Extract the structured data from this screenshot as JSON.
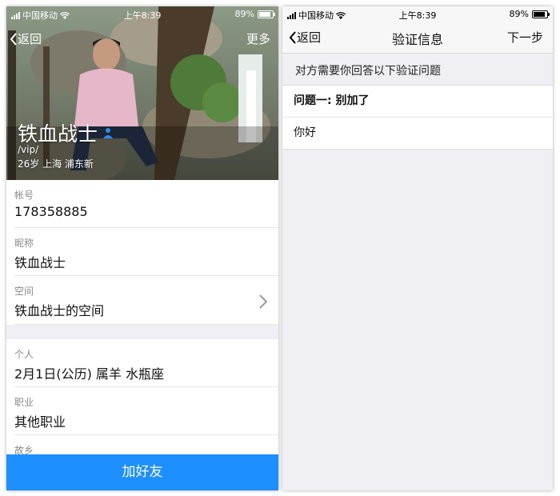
{
  "status_left": {
    "carrier": "中国移动",
    "time": "上午8:39",
    "battery": "89%"
  },
  "status_right": {
    "carrier": "中国移动",
    "time": "上午8:39",
    "battery": "89%"
  },
  "profile": {
    "back_label": "返回",
    "more_label": "更多",
    "name": "铁血战士",
    "vip": "/vip/",
    "info": "26岁 上海 浦东新",
    "rows": [
      {
        "label": "帐号",
        "value": "178358885"
      },
      {
        "label": "昵称",
        "value": "铁血战士"
      },
      {
        "label": "空间",
        "value": "铁血战士的空间"
      },
      {
        "label": "个人",
        "value": "2月1日(公历) 属羊 水瓶座"
      },
      {
        "label": "职业",
        "value": "其他职业"
      },
      {
        "label": "故乡",
        "value": ""
      }
    ],
    "add_friend_label": "加好友"
  },
  "verify": {
    "back_label": "返回",
    "title": "验证信息",
    "next_label": "下一步",
    "hint": "对方需要你回答以下验证问题",
    "question": "问题一: 别加了",
    "answer": "你好"
  },
  "colors": {
    "accent": "#1e8fff",
    "background": "#efeff4"
  }
}
